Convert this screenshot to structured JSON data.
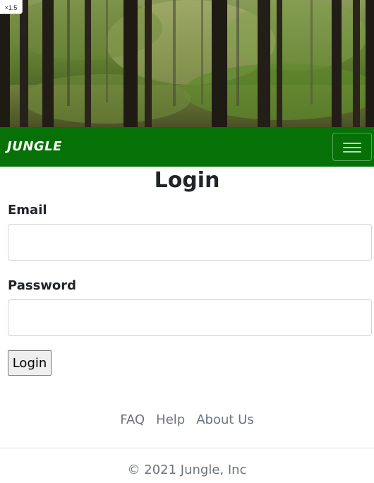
{
  "zoom_badge": "×1.5",
  "navbar": {
    "brand": "JUNGLE",
    "toggler_icon": "hamburger-icon",
    "color": "#067106"
  },
  "form": {
    "title": "Login",
    "email_label": "Email",
    "email_value": "",
    "password_label": "Password",
    "password_value": "",
    "submit_label": "Login"
  },
  "footer": {
    "links": [
      "FAQ",
      "Help",
      "About Us"
    ],
    "copyright": "© 2021 Jungle, Inc"
  }
}
